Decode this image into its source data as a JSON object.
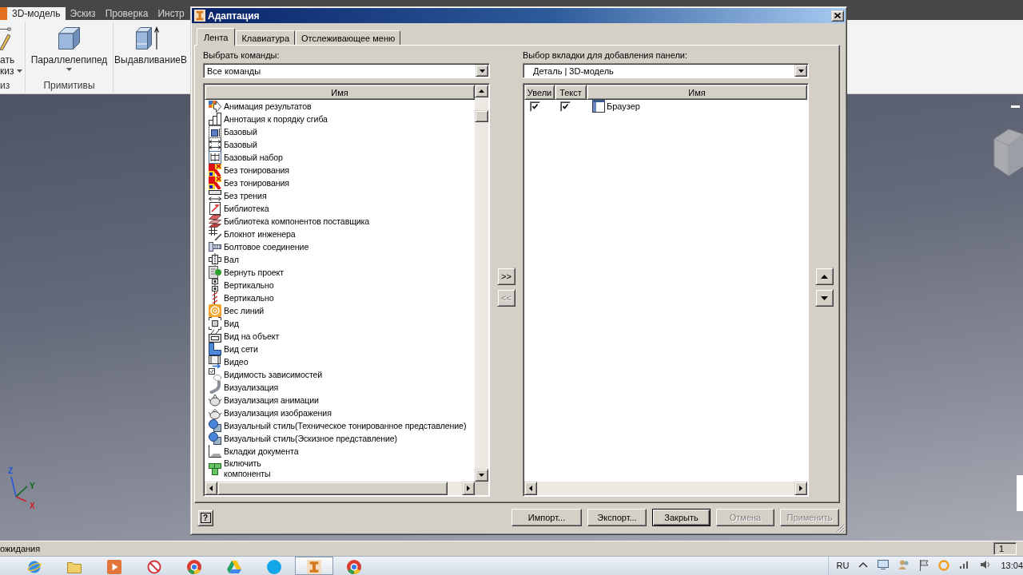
{
  "app": {
    "ribbon_tabs": [
      {
        "label": "3D-модель",
        "selected": true
      },
      {
        "label": "Эскиз",
        "selected": false
      },
      {
        "label": "Проверка",
        "selected": false
      },
      {
        "label": "Инстр",
        "selected": false
      }
    ],
    "ribbon_groups": [
      {
        "label": "из",
        "buttons": [
          {
            "lines": [
              "ать",
              "киз"
            ],
            "dropdown": true
          }
        ]
      },
      {
        "label": "Примитивы",
        "buttons": [
          {
            "lines": [
              "Параллелепипед"
            ],
            "dropdown": true
          }
        ]
      },
      {
        "buttons": [
          {
            "lines": [
              "Выдавливание"
            ],
            "dropdown": false
          },
          {
            "lines": [
              "В"
            ],
            "dropdown": false
          }
        ]
      }
    ]
  },
  "viewport": {
    "axes": [
      {
        "label": "Z",
        "color": "#2457d6"
      },
      {
        "label": "Y",
        "color": "#05661a"
      },
      {
        "label": "X",
        "color": "#d0202a"
      }
    ]
  },
  "dialog": {
    "title": "Адаптация",
    "tabs": [
      {
        "label": "Лента",
        "selected": true
      },
      {
        "label": "Клавиатура",
        "selected": false
      },
      {
        "label": "Отслеживающее меню",
        "selected": false
      }
    ],
    "commands": {
      "label": "Выбрать команды:",
      "filter": "Все команды",
      "column": "Имя",
      "items": [
        {
          "label": "Анимация результатов",
          "selected": false
        },
        {
          "label": "Аннотация к порядку сгиба",
          "selected": false
        },
        {
          "label": "Базовый",
          "selected": false
        },
        {
          "label": "Базовый",
          "selected": false
        },
        {
          "label": "Базовый набор",
          "selected": false
        },
        {
          "label": "Без тонирования",
          "selected": false
        },
        {
          "label": "Без тонирования",
          "selected": false
        },
        {
          "label": "Без трения",
          "selected": false
        },
        {
          "label": "Библиотека",
          "selected": false
        },
        {
          "label": "Библиотека компонентов поставщика",
          "selected": false
        },
        {
          "label": "Блокнот инженера",
          "selected": false
        },
        {
          "label": "Болтовое соединение",
          "selected": false
        },
        {
          "label": "Вал",
          "selected": false
        },
        {
          "label": "Вернуть проект",
          "selected": false
        },
        {
          "label": "Вертикально",
          "selected": false
        },
        {
          "label": "Вертикально",
          "selected": false
        },
        {
          "label": "Вес линий",
          "selected": false
        },
        {
          "label": "Вид",
          "selected": false
        },
        {
          "label": "Вид на объект",
          "selected": false
        },
        {
          "label": "Вид сети",
          "selected": false
        },
        {
          "label": "Видео",
          "selected": false
        },
        {
          "label": "Видимость зависимостей",
          "selected": false
        },
        {
          "label": "Визуализация",
          "selected": false
        },
        {
          "label": "Визуализация анимации",
          "selected": false
        },
        {
          "label": "Визуализация изображения",
          "selected": false
        },
        {
          "label": "Визуальный стиль(Техническое тонированное представление)",
          "selected": false
        },
        {
          "label": "Визуальный стиль(Эскизное представление)",
          "selected": false
        },
        {
          "label": "Вкладки документа",
          "selected": false
        },
        {
          "label": "Включить\nкомпоненты",
          "selected": false
        }
      ]
    },
    "move_buttons": [
      {
        "label": ">>",
        "disabled": false
      },
      {
        "label": "<<",
        "disabled": true
      }
    ],
    "target": {
      "label": "Выбор вкладки для добавления панели:",
      "tab": "Деталь | 3D-модель",
      "columns": [
        "Увели",
        "Текст",
        "Имя"
      ],
      "rows": [
        {
          "checks": [
            {
              "checked": true
            },
            {
              "checked": true
            }
          ],
          "name": "Браузер",
          "selected": false
        }
      ]
    },
    "help_button": "?",
    "buttons": [
      {
        "label": "Импорт...",
        "default": false,
        "disabled": false
      },
      {
        "label": "Экспорт...",
        "default": false,
        "disabled": false
      },
      {
        "label": "Закрыть",
        "default": true,
        "disabled": false
      },
      {
        "label": "Отмена",
        "default": false,
        "disabled": true
      },
      {
        "label": "Применить",
        "default": false,
        "disabled": true
      }
    ]
  },
  "status_bar": {
    "text": "ожидания",
    "field": "1"
  },
  "taskbar": {
    "apps": [
      {
        "selected": false
      },
      {
        "selected": false
      },
      {
        "selected": false
      },
      {
        "selected": false
      },
      {
        "selected": false
      },
      {
        "selected": false
      },
      {
        "selected": false
      },
      {
        "selected": true
      },
      {
        "selected": false
      }
    ],
    "language": "RU",
    "clock": "13:04"
  }
}
